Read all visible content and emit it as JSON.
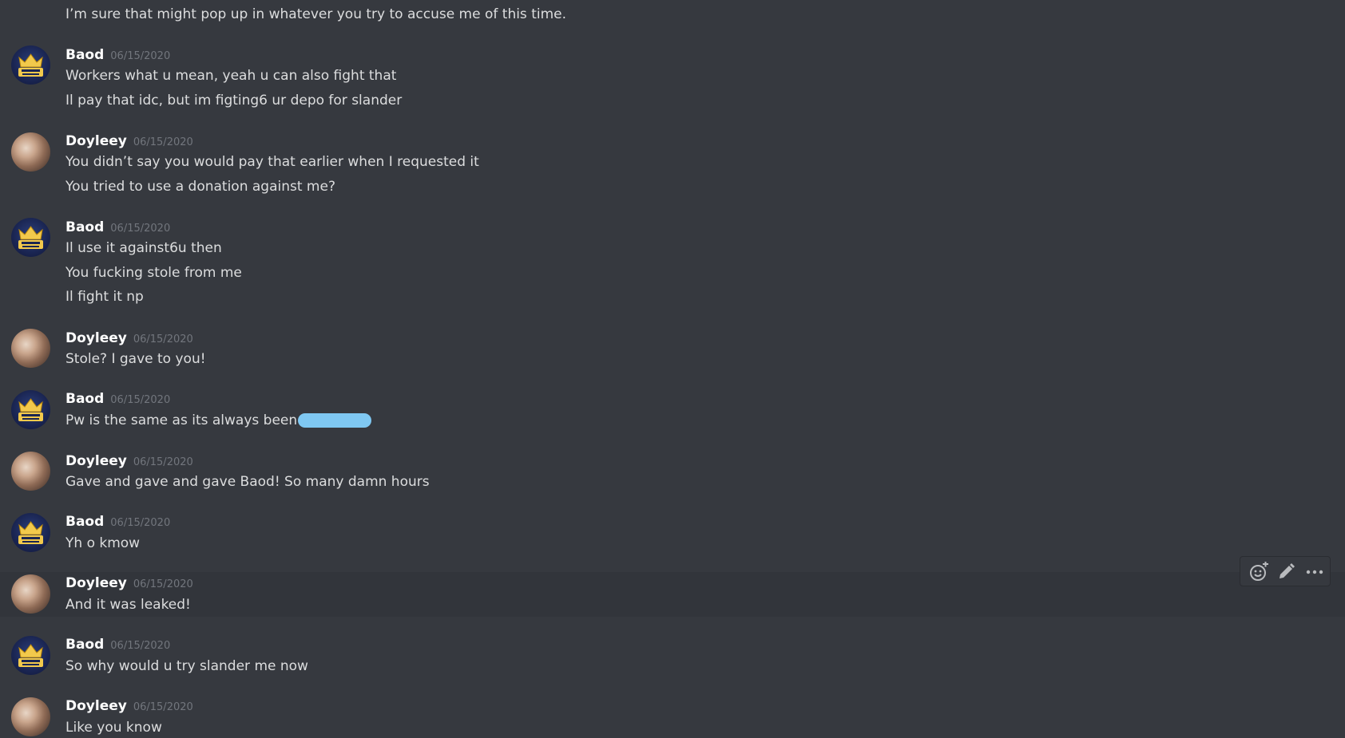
{
  "messages": [
    {
      "text": "I’m sure that might pop up in whatever you try to accuse me of this time."
    },
    {
      "author": "Baod",
      "ts": "06/15/2020",
      "lines": [
        "Workers what u mean, yeah u can also fight that",
        "Il pay that idc, but im figting6 ur depo for slander"
      ]
    },
    {
      "author": "Doyleey",
      "ts": "06/15/2020",
      "lines": [
        "You didn’t say you would pay that earlier when I requested it",
        "You tried to use a donation against me?"
      ]
    },
    {
      "author": "Baod",
      "ts": "06/15/2020",
      "lines": [
        "Il use it against6u then",
        "You fucking stole from me",
        "Il fight it np"
      ]
    },
    {
      "author": "Doyleey",
      "ts": "06/15/2020",
      "lines": [
        "Stole? I gave to you!"
      ]
    },
    {
      "author": "Baod",
      "ts": "06/15/2020",
      "lines": [
        "Pw is the same as its always been"
      ]
    },
    {
      "author": "Doyleey",
      "ts": "06/15/2020",
      "lines": [
        "Gave and gave and gave Baod! So many damn hours"
      ]
    },
    {
      "author": "Baod",
      "ts": "06/15/2020",
      "lines": [
        "Yh o kmow"
      ]
    },
    {
      "author": "Doyleey",
      "ts": "06/15/2020",
      "lines": [
        "And it was leaked!"
      ]
    },
    {
      "author": "Baod",
      "ts": "06/15/2020",
      "lines": [
        "So why would u try slander me now"
      ]
    },
    {
      "author": "Doyleey",
      "ts": "06/15/2020",
      "lines": [
        "Like you know"
      ]
    }
  ],
  "toolbar": {
    "icons": [
      "add-reaction-icon",
      "edit-icon",
      "more-icon"
    ]
  },
  "colors": {
    "background": "#36393f",
    "hover": "#32353b",
    "text": "#dcddde",
    "author": "#ffffff",
    "timestamp": "#72767d",
    "redaction": "#7fc8f2"
  }
}
